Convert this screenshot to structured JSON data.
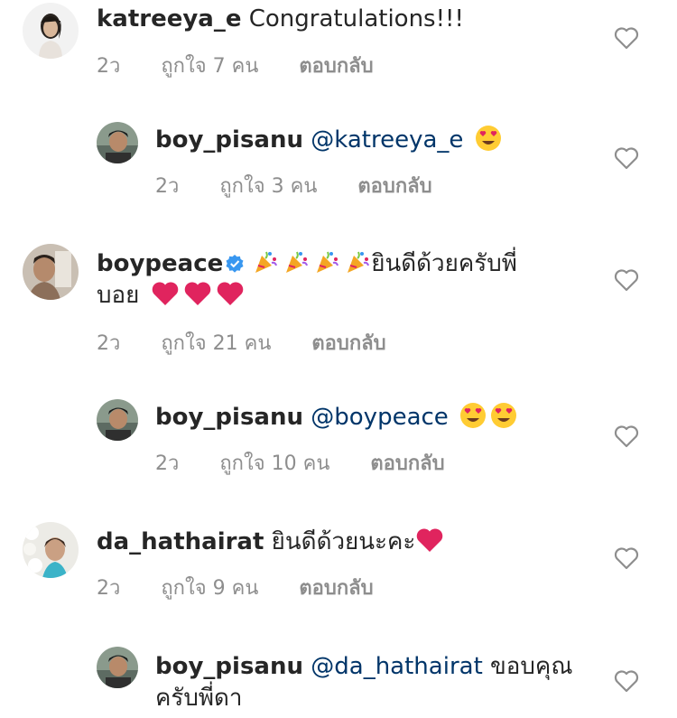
{
  "comments": [
    {
      "username": "katreeya_e",
      "text": "Congratulations!!!",
      "time": "2ว",
      "likes": "ถูกใจ 7 คน",
      "reply": "ตอบกลับ"
    },
    {
      "username": "boy_pisanu",
      "mention": "@katreeya_e",
      "time": "2ว",
      "likes": "ถูกใจ 3 คน",
      "reply": "ตอบกลับ"
    },
    {
      "username": "boypeace",
      "verified": true,
      "text_line1": "ยินดีด้วยครับพี่",
      "text_line2": "บอย",
      "time": "2ว",
      "likes": "ถูกใจ 21 คน",
      "reply": "ตอบกลับ"
    },
    {
      "username": "boy_pisanu",
      "mention": "@boypeace",
      "time": "2ว",
      "likes": "ถูกใจ 10 คน",
      "reply": "ตอบกลับ"
    },
    {
      "username": "da_hathairat",
      "text": "ยินดีด้วยนะคะ",
      "time": "2ว",
      "likes": "ถูกใจ 9 คน",
      "reply": "ตอบกลับ"
    },
    {
      "username": "boy_pisanu",
      "mention": "@da_hathairat",
      "text": "ขอบคุณ",
      "text_line2": "ครับพี่ดา"
    }
  ],
  "colors": {
    "text": "#262626",
    "meta": "#8e8e8e",
    "mention": "#003569",
    "verified": "#3897f0",
    "heart_emoji": "#e0245e"
  },
  "icons": [
    "heart-outline-icon",
    "heart-emoji-icon",
    "heart-eyes-emoji-icon",
    "party-popper-emoji-icon",
    "verified-badge-icon"
  ]
}
